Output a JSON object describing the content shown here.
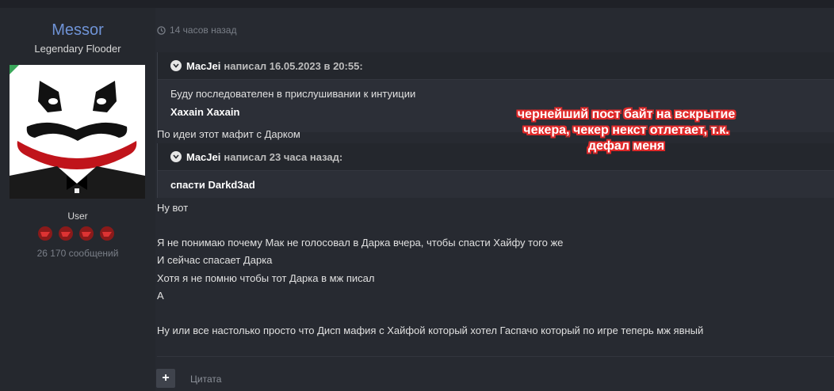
{
  "user": {
    "name": "Messor",
    "title": "Legendary Flooder",
    "role": "User",
    "post_count": "26 170 сообщений"
  },
  "post": {
    "time": "14 часов назад",
    "quote1": {
      "author": "MacJei",
      "meta": "написал 16.05.2023 в 20:55:",
      "line1": "Буду последователен в прислушивании к интуиции",
      "line2": "Xaxain Xaxain"
    },
    "line_after_quote1": "По идеи этот мафит с Дарком",
    "quote2": {
      "author": "MacJei",
      "meta": "написал 23 часа назад:",
      "line1": "спасти Darkd3ad"
    },
    "lines": [
      "Ну вот",
      "Я не понимаю почему Мак не голосовал в Дарка вчера, чтобы спасти Хайфу того же",
      "И сейчас спасает Дарка",
      "Хотя я не помню чтобы тот Дарка в мж писал",
      "А",
      "Ну или все настолько просто что Дисп мафия с Хайфой который хотел Гаспачо который по игре теперь мж явный"
    ]
  },
  "overlay": {
    "line1": "чернейший пост байт на вскрытие",
    "line2": "чекера, чекер некст отлетает, т.к.",
    "line3": "дефал меня"
  },
  "actions": {
    "plus": "+",
    "quote": "Цитата"
  },
  "colors": {
    "username": "#6f93d6",
    "overlay_outline": "#e12a2a"
  },
  "icons": [
    "clock-icon",
    "chevron-down-icon",
    "joker-avatar",
    "reputation-star-icon"
  ]
}
